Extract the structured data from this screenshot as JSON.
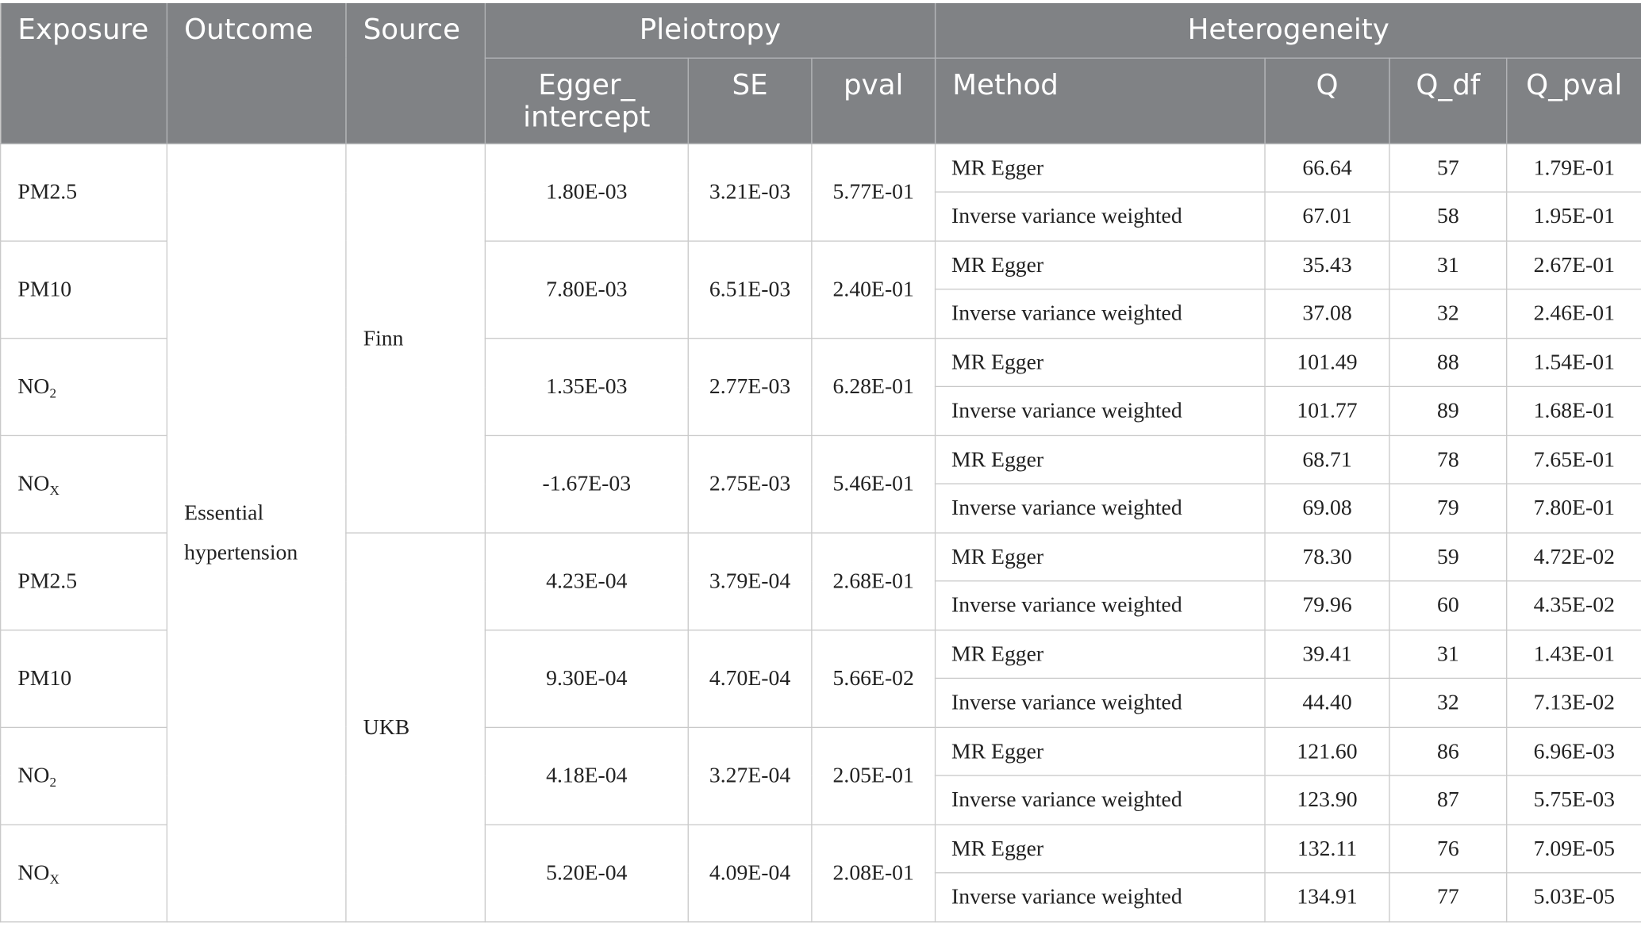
{
  "headers": {
    "exposure": "Exposure",
    "outcome": "Outcome",
    "source": "Source",
    "pleiotropy": "Pleiotropy",
    "heterogeneity": "Heterogeneity",
    "egger_intercept": "Egger_ intercept",
    "se": "SE",
    "pval": "pval",
    "method": "Method",
    "q": "Q",
    "q_df": "Q_df",
    "q_pval": "Q_pval"
  },
  "outcome": "Essential hypertension",
  "sources": [
    "Finn",
    "UKB"
  ],
  "exposures": [
    {
      "base": "PM2.5",
      "sub": "",
      "egger_intercept": "1.80E-03",
      "se": "3.21E-03",
      "pval": "5.77E-01",
      "methods": [
        {
          "method": "MR Egger",
          "q": "66.64",
          "q_df": "57",
          "q_pval": "1.79E-01"
        },
        {
          "method": "Inverse variance weighted",
          "q": "67.01",
          "q_df": "58",
          "q_pval": "1.95E-01"
        }
      ]
    },
    {
      "base": "PM10",
      "sub": "",
      "egger_intercept": "7.80E-03",
      "se": "6.51E-03",
      "pval": "2.40E-01",
      "methods": [
        {
          "method": "MR Egger",
          "q": "35.43",
          "q_df": "31",
          "q_pval": "2.67E-01"
        },
        {
          "method": "Inverse variance weighted",
          "q": "37.08",
          "q_df": "32",
          "q_pval": "2.46E-01"
        }
      ]
    },
    {
      "base": "NO",
      "sub": "2",
      "egger_intercept": "1.35E-03",
      "se": "2.77E-03",
      "pval": "6.28E-01",
      "methods": [
        {
          "method": "MR Egger",
          "q": "101.49",
          "q_df": "88",
          "q_pval": "1.54E-01"
        },
        {
          "method": "Inverse variance weighted",
          "q": "101.77",
          "q_df": "89",
          "q_pval": "1.68E-01"
        }
      ]
    },
    {
      "base": "NO",
      "sub": "X",
      "egger_intercept": "-1.67E-03",
      "se": "2.75E-03",
      "pval": "5.46E-01",
      "methods": [
        {
          "method": "MR Egger",
          "q": "68.71",
          "q_df": "78",
          "q_pval": "7.65E-01"
        },
        {
          "method": "Inverse variance weighted",
          "q": "69.08",
          "q_df": "79",
          "q_pval": "7.80E-01"
        }
      ]
    },
    {
      "base": "PM2.5",
      "sub": "",
      "egger_intercept": "4.23E-04",
      "se": "3.79E-04",
      "pval": "2.68E-01",
      "methods": [
        {
          "method": "MR Egger",
          "q": "78.30",
          "q_df": "59",
          "q_pval": "4.72E-02"
        },
        {
          "method": "Inverse variance weighted",
          "q": "79.96",
          "q_df": "60",
          "q_pval": "4.35E-02"
        }
      ]
    },
    {
      "base": "PM10",
      "sub": "",
      "egger_intercept": "9.30E-04",
      "se": "4.70E-04",
      "pval": "5.66E-02",
      "methods": [
        {
          "method": "MR Egger",
          "q": "39.41",
          "q_df": "31",
          "q_pval": "1.43E-01"
        },
        {
          "method": "Inverse variance weighted",
          "q": "44.40",
          "q_df": "32",
          "q_pval": "7.13E-02"
        }
      ]
    },
    {
      "base": "NO",
      "sub": "2",
      "egger_intercept": "4.18E-04",
      "se": "3.27E-04",
      "pval": "2.05E-01",
      "methods": [
        {
          "method": "MR Egger",
          "q": "121.60",
          "q_df": "86",
          "q_pval": "6.96E-03"
        },
        {
          "method": "Inverse variance weighted",
          "q": "123.90",
          "q_df": "87",
          "q_pval": "5.75E-03"
        }
      ]
    },
    {
      "base": "NO",
      "sub": "X",
      "egger_intercept": "5.20E-04",
      "se": "4.09E-04",
      "pval": "2.08E-01",
      "methods": [
        {
          "method": "MR Egger",
          "q": "132.11",
          "q_df": "76",
          "q_pval": "7.09E-05"
        },
        {
          "method": "Inverse variance weighted",
          "q": "134.91",
          "q_df": "77",
          "q_pval": "5.03E-05"
        }
      ]
    }
  ]
}
